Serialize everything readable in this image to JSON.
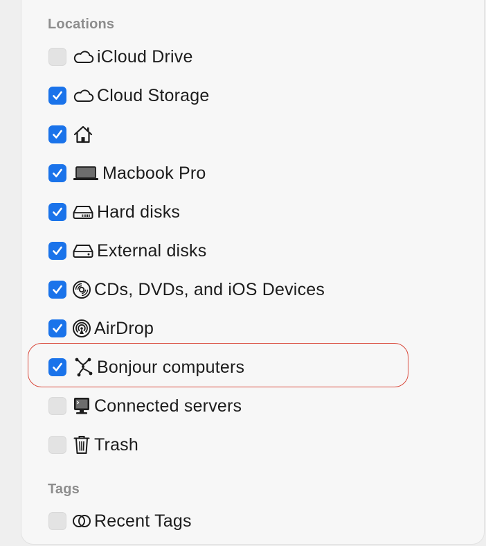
{
  "sections": {
    "locations_title": "Locations",
    "tags_title": "Tags"
  },
  "locations": [
    {
      "label": "iCloud Drive",
      "checked": false,
      "icon": "cloud-icon"
    },
    {
      "label": "Cloud Storage",
      "checked": true,
      "icon": "cloud-icon"
    },
    {
      "label": "",
      "checked": true,
      "icon": "home-icon"
    },
    {
      "label": "Macbook Pro",
      "checked": true,
      "icon": "laptop-icon"
    },
    {
      "label": "Hard disks",
      "checked": true,
      "icon": "hard-disk-icon"
    },
    {
      "label": "External disks",
      "checked": true,
      "icon": "external-disk-icon"
    },
    {
      "label": "CDs, DVDs, and iOS Devices",
      "checked": true,
      "icon": "cd-icon"
    },
    {
      "label": "AirDrop",
      "checked": true,
      "icon": "airdrop-icon"
    },
    {
      "label": "Bonjour computers",
      "checked": true,
      "icon": "bonjour-icon"
    },
    {
      "label": "Connected servers",
      "checked": false,
      "icon": "server-icon"
    },
    {
      "label": "Trash",
      "checked": false,
      "icon": "trash-icon"
    }
  ],
  "tags": [
    {
      "label": "Recent Tags",
      "checked": false,
      "icon": "tags-icon"
    }
  ],
  "colors": {
    "accent": "#1a73ea",
    "highlight": "#d9483b",
    "section_title": "#8d8d8d"
  }
}
